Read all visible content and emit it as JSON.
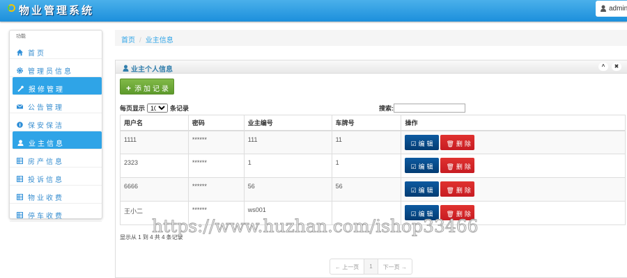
{
  "header": {
    "title": "物业管理系统",
    "user": "admin"
  },
  "sidebar": {
    "heading": "功能",
    "items": [
      {
        "label": "首页",
        "icon": "home-icon",
        "active": false
      },
      {
        "label": "管理员信息",
        "icon": "gear-icon",
        "active": false
      },
      {
        "label": "报修管理",
        "icon": "wrench-icon",
        "active": true
      },
      {
        "label": "公告管理",
        "icon": "envelope-icon",
        "active": false
      },
      {
        "label": "保安保洁",
        "icon": "info-icon",
        "active": false
      },
      {
        "label": "业主信息",
        "icon": "user-icon",
        "active": true
      },
      {
        "label": "房产信息",
        "icon": "list-icon",
        "active": false
      },
      {
        "label": "投诉信息",
        "icon": "list-icon",
        "active": false
      },
      {
        "label": "物业收费",
        "icon": "list-icon",
        "active": false
      },
      {
        "label": "停车收费",
        "icon": "list-icon",
        "active": false
      }
    ]
  },
  "breadcrumb": {
    "home": "首页",
    "sep": "/",
    "current": "业主信息"
  },
  "panel": {
    "title": "业主个人信息",
    "collapse": "^",
    "close": "✖"
  },
  "add_label": "添加记录",
  "length": {
    "prefix": "每页显示",
    "value": "10",
    "suffix": "条记录"
  },
  "search_label": "搜索:",
  "table": {
    "headers": [
      "用户名",
      "密码",
      "业主编号",
      "车牌号",
      "操作"
    ],
    "rows": [
      [
        "1111",
        "******",
        "111",
        "11"
      ],
      [
        "2323",
        "******",
        "1",
        "1"
      ],
      [
        "6666",
        "******",
        "56",
        "56"
      ],
      [
        "王小二",
        "******",
        "ws001",
        ""
      ]
    ],
    "edit_label": "编辑",
    "delete_label": "删除"
  },
  "info": "显示从 1 到 4 共 4 条记录",
  "pagination": {
    "prev": "← 上一页",
    "page": "1",
    "next": "下一页 →"
  },
  "watermark": "https://www.huzhan.com/ishop33466"
}
